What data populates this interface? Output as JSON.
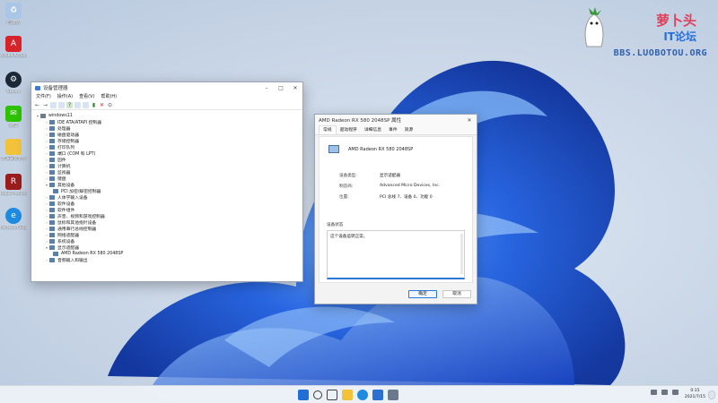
{
  "desktop": {
    "icons": [
      {
        "label": "回收站",
        "color": "#a9c6e6",
        "icon": "recycle-bin-icon"
      },
      {
        "label": "Adobe Acrobat...",
        "color": "#d6242a",
        "icon": "pdf-icon"
      },
      {
        "label": "Steam",
        "color": "#1b2838",
        "icon": "steam-icon"
      },
      {
        "label": "微信",
        "color": "#2dc100",
        "icon": "wechat-icon"
      },
      {
        "label": "无法安装文件",
        "color": "#f2c23a",
        "icon": "folder-icon"
      },
      {
        "label": "Rapid Peripheral...",
        "color": "#9b1c1c",
        "icon": "app-icon"
      },
      {
        "label": "Microsoft Edge",
        "color": "#1f8be0",
        "icon": "edge-icon"
      }
    ]
  },
  "watermark": {
    "title": "萝卜头",
    "subtitle": "IT论坛",
    "url": "BBS.LUOBOTOU.ORG"
  },
  "device_manager": {
    "title": "设备管理器",
    "menu": [
      "文件(F)",
      "操作(A)",
      "查看(V)",
      "帮助(H)"
    ],
    "root": "windows11",
    "items": [
      {
        "label": "IDE ATA/ATAPI 控制器",
        "expanded": false
      },
      {
        "label": "处理器",
        "expanded": false
      },
      {
        "label": "磁盘驱动器",
        "expanded": false
      },
      {
        "label": "存储控制器",
        "expanded": false
      },
      {
        "label": "打印队列",
        "expanded": false
      },
      {
        "label": "端口 (COM 和 LPT)",
        "expanded": false
      },
      {
        "label": "固件",
        "expanded": false
      },
      {
        "label": "计算机",
        "expanded": false
      },
      {
        "label": "监视器",
        "expanded": false
      },
      {
        "label": "键盘",
        "expanded": false
      },
      {
        "label": "其他设备",
        "expanded": true
      },
      {
        "label": "PCI 加密/解密控制器",
        "child": true
      },
      {
        "label": "人体学输入设备",
        "expanded": false
      },
      {
        "label": "软件设备",
        "expanded": false
      },
      {
        "label": "软件组件",
        "expanded": false
      },
      {
        "label": "声音、视频和游戏控制器",
        "expanded": false
      },
      {
        "label": "鼠标和其他指针设备",
        "expanded": false
      },
      {
        "label": "通用串行总线控制器",
        "expanded": false
      },
      {
        "label": "网络适配器",
        "expanded": false
      },
      {
        "label": "系统设备",
        "expanded": false
      },
      {
        "label": "显示适配器",
        "expanded": true
      },
      {
        "label": "AMD Radeon RX 580 2048SP",
        "child": true
      },
      {
        "label": "音频输入和输出",
        "expanded": false
      }
    ]
  },
  "properties": {
    "title": "AMD Radeon RX 580 2048SP 属性",
    "tabs": [
      "常规",
      "驱动程序",
      "详细信息",
      "事件",
      "资源"
    ],
    "device_name": "AMD Radeon RX 580 2048SP",
    "device_type_label": "设备类型:",
    "device_type": "显示适配器",
    "manufacturer_label": "制造商:",
    "manufacturer": "Advanced Micro Devices, Inc.",
    "location_label": "位置:",
    "location": "PCI 总线 7、设备 0、功能 0",
    "status_caption": "设备状态",
    "status_text": "这个设备运转正常。",
    "ok": "确定",
    "cancel": "取消"
  },
  "taskbar": {
    "apps": [
      {
        "icon": "start-icon",
        "color": "#1f6fd6"
      },
      {
        "icon": "search-icon",
        "color": "#3a3a3a"
      },
      {
        "icon": "task-view-icon",
        "color": "#444"
      },
      {
        "icon": "file-explorer-icon",
        "color": "#f2c23a"
      },
      {
        "icon": "edge-icon",
        "color": "#1f8be0"
      },
      {
        "icon": "store-icon",
        "color": "#2b6fd1"
      },
      {
        "icon": "device-manager-icon",
        "color": "#6a7a8c"
      }
    ],
    "time": "0:15",
    "date": "2021/7/15"
  }
}
